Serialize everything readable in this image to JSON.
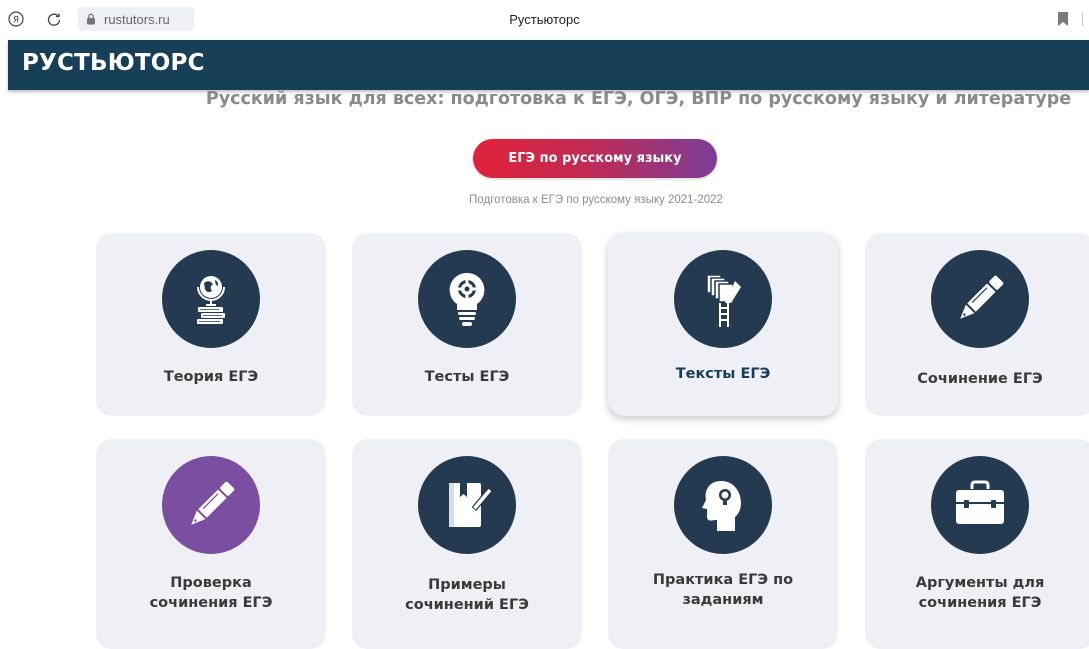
{
  "browser": {
    "url": "rustutors.ru",
    "tab_title": "Рустьюторс"
  },
  "site": {
    "logo": "РУСТЬЮТОРС",
    "subtitle": "Русский язык для всех: подготовка к ЕГЭ, ОГЭ, ВПР по русскому языку и литературе",
    "cta_label": "ЕГЭ по русскому языку",
    "cta_caption": "Подготовка к ЕГЭ по русскому языку 2021-2022"
  },
  "cards": [
    {
      "label": "Теория ЕГЭ",
      "icon": "globe-books-icon"
    },
    {
      "label": "Тесты ЕГЭ",
      "icon": "lightbulb-gear-icon"
    },
    {
      "label": "Тексты ЕГЭ",
      "icon": "papers-ladder-icon"
    },
    {
      "label": "Сочинение ЕГЭ",
      "icon": "pen-icon"
    },
    {
      "label": "Проверка сочинения ЕГЭ",
      "icon": "pen-icon"
    },
    {
      "label": "Примеры сочинений ЕГЭ",
      "icon": "notebook-pen-icon"
    },
    {
      "label": "Практика ЕГЭ по заданиям",
      "icon": "head-lightbulb-icon"
    },
    {
      "label": "Аргументы для сочинения ЕГЭ",
      "icon": "briefcase-icon"
    }
  ],
  "colors": {
    "header": "#173f57",
    "icon_circle": "#233a50",
    "icon_circle_highlight": "#7a4ea0",
    "cta_gradient_start": "#e0233b",
    "cta_gradient_end": "#7c3d97"
  }
}
